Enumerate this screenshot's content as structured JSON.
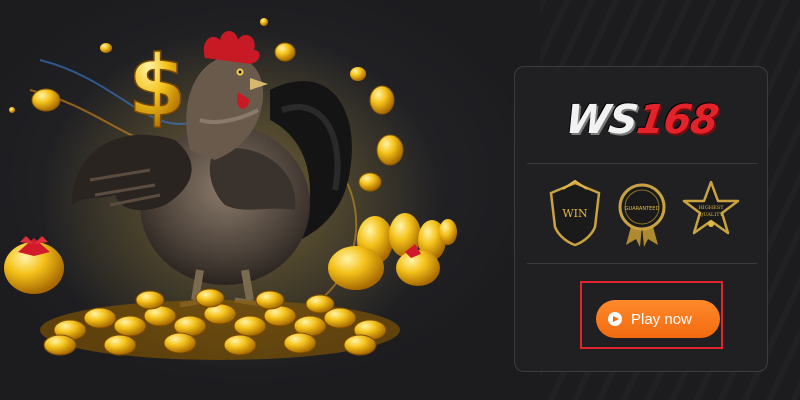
{
  "brand": {
    "logo_text_letters": "WS",
    "logo_text_number": "168",
    "accent_color": "#e3222a"
  },
  "badges": [
    {
      "icon": "win-shield-badge-icon",
      "text": "WIN"
    },
    {
      "icon": "guaranteed-seal-badge-icon",
      "text": "GUARANTEED"
    },
    {
      "icon": "highest-quality-star-badge-icon",
      "text_line1": "HIGHEST",
      "text_line2": "QUALITY"
    }
  ],
  "cta": {
    "label": "Play now",
    "button_color": "#f26a10",
    "highlight_color": "#e0262c"
  },
  "hero": {
    "illustration": "rooster-gold-coins-illustration"
  }
}
